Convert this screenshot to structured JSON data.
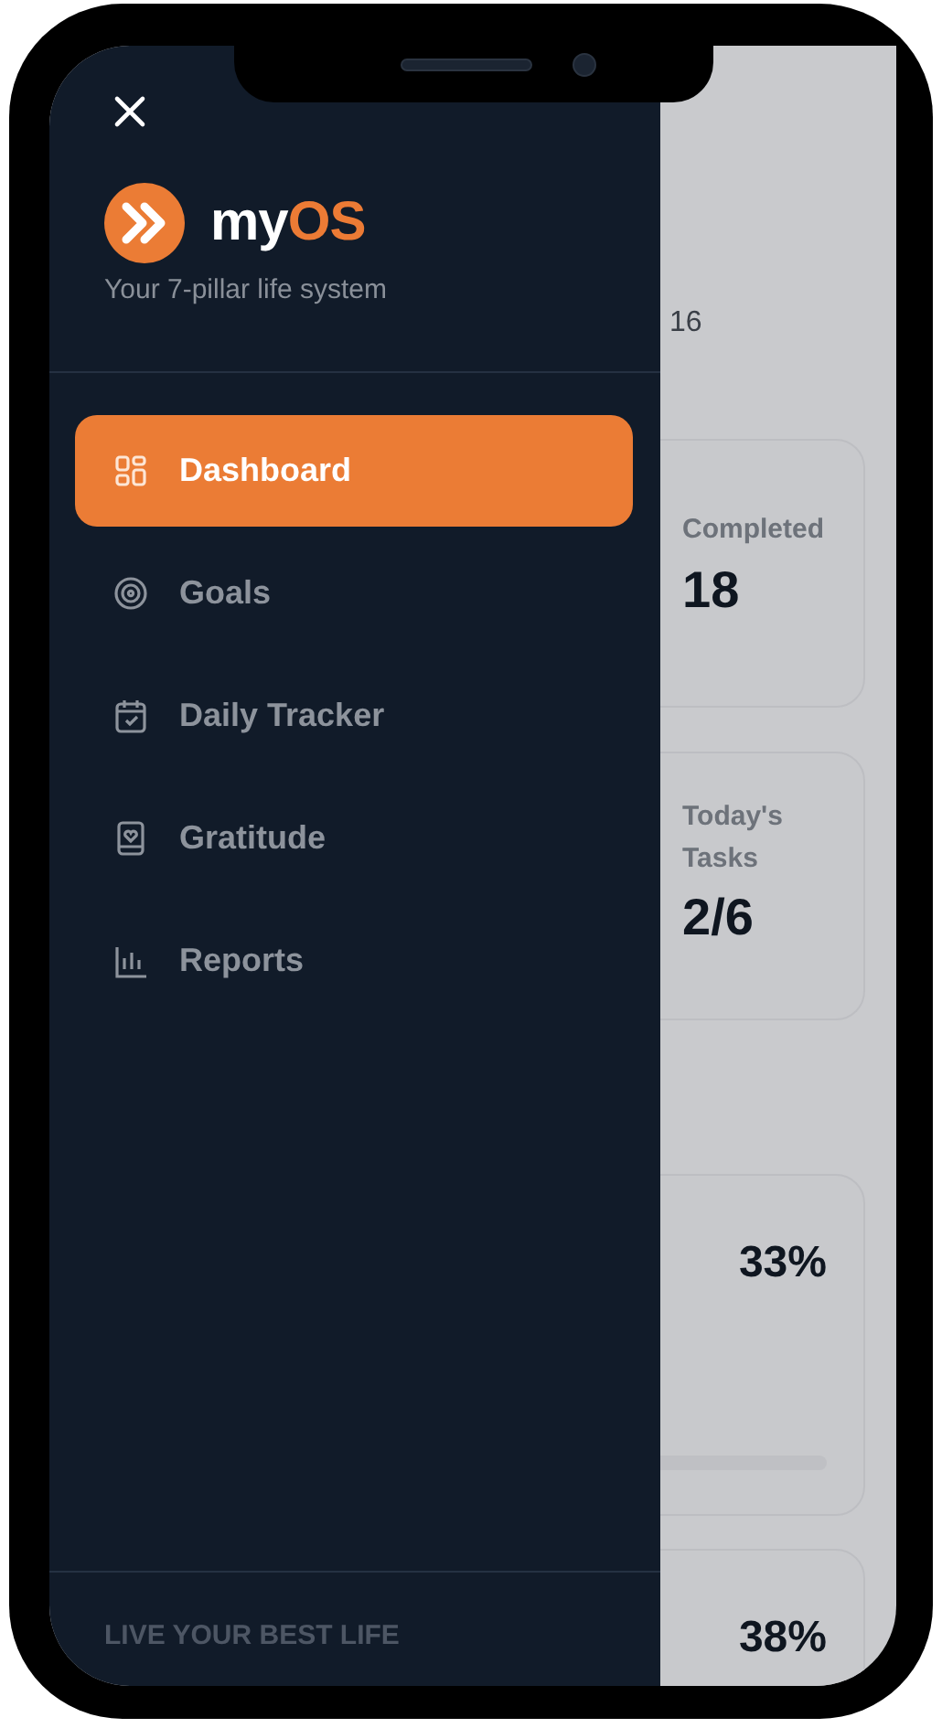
{
  "drawer": {
    "brand": {
      "prefix": "my",
      "highlight": "OS"
    },
    "tagline": "Your 7-pillar life system",
    "nav": [
      {
        "label": "Dashboard",
        "selected": true
      },
      {
        "label": "Goals",
        "selected": false
      },
      {
        "label": "Daily Tracker",
        "selected": false
      },
      {
        "label": "Gratitude",
        "selected": false
      },
      {
        "label": "Reports",
        "selected": false
      }
    ],
    "footer": "LIVE YOUR BEST LIFE"
  },
  "background": {
    "date_fragment": "16",
    "stats": [
      {
        "label": "Completed",
        "value": "18"
      },
      {
        "label": "Today's Tasks",
        "value": "2/6"
      }
    ],
    "progress_cards": [
      {
        "value": "33%"
      },
      {
        "value": "38%"
      }
    ]
  }
}
